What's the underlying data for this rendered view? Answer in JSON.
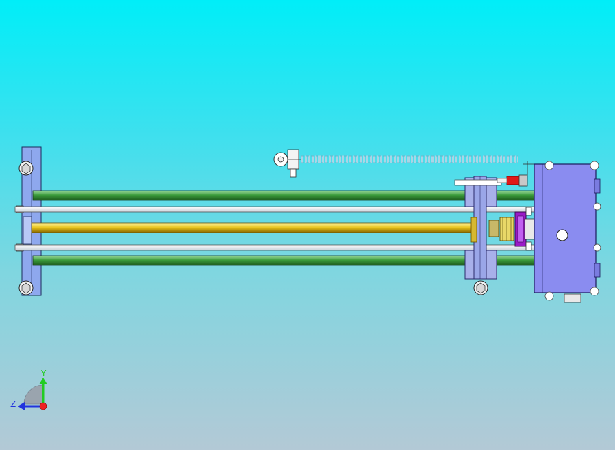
{
  "viewport": {
    "background_top": "#00eef8",
    "background_bottom": "#b3c9d6"
  },
  "axis_triad": {
    "y_label": "Y",
    "z_label": "Z",
    "y_color": "#22cc22",
    "z_color": "#2233dd",
    "x_color": "#ee2222"
  },
  "colors": {
    "guide_rod": "#3a9a3a",
    "lead_screw": "#e8c21a",
    "plate": "#8ea8ee",
    "motor_box": "#8a8cf0",
    "coupling": "#9a1ac8",
    "spring": "#a8d6e6",
    "red_clip": "#e01818"
  }
}
